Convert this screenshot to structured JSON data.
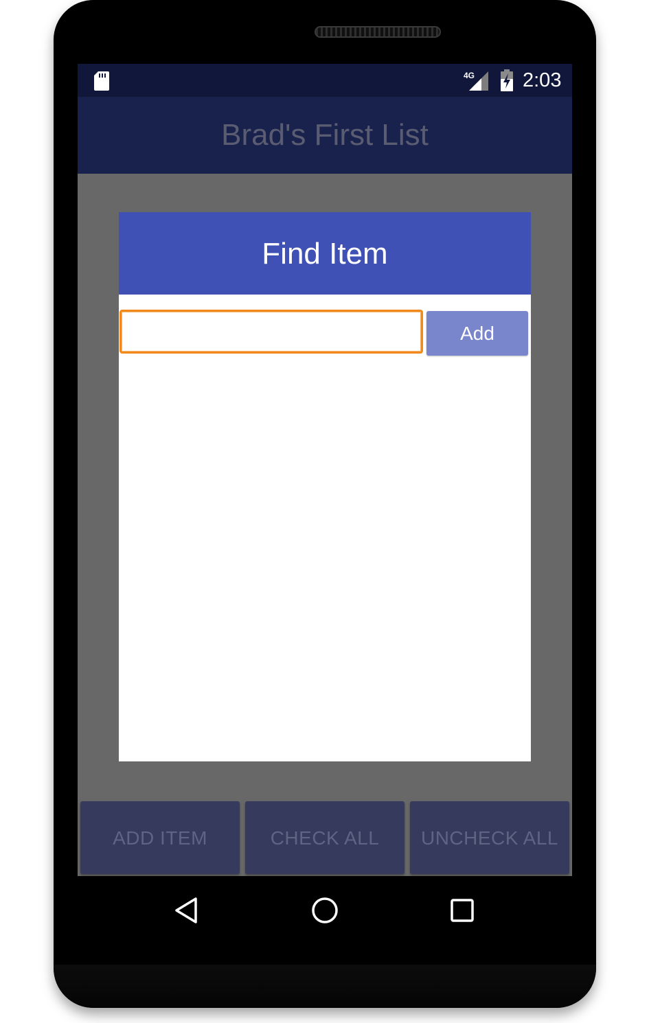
{
  "status_bar": {
    "network": "4G",
    "time": "2:03",
    "icons": [
      "sd-card-icon",
      "signal-4g-icon",
      "battery-charging-icon"
    ]
  },
  "app_bar": {
    "title": "Brad's First List"
  },
  "dialog": {
    "title": "Find Item",
    "input": {
      "value": "",
      "placeholder": ""
    },
    "add_label": "Add"
  },
  "actions": {
    "add_item": "ADD ITEM",
    "check_all": "CHECK ALL",
    "uncheck_all": "UNCHECK ALL"
  },
  "nav": {
    "icons": [
      "back-icon",
      "home-icon",
      "recents-icon"
    ]
  },
  "colors": {
    "status_bar": "#11173a",
    "app_bar": "#19214d",
    "dialog_header": "#3f51b5",
    "add_button": "#7986cb",
    "input_focus": "#f08a1c",
    "overlay": "#686868",
    "bottom_button": "#363b5e"
  }
}
